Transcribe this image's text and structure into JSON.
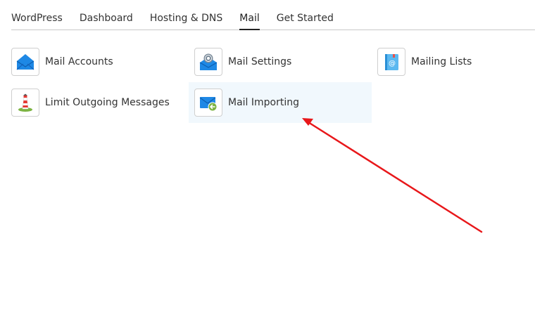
{
  "tabs": [
    {
      "label": "WordPress",
      "active": false
    },
    {
      "label": "Dashboard",
      "active": false
    },
    {
      "label": "Hosting & DNS",
      "active": false
    },
    {
      "label": "Mail",
      "active": true
    },
    {
      "label": "Get Started",
      "active": false
    }
  ],
  "tools": {
    "mail_accounts": {
      "label": "Mail Accounts",
      "icon": "mail-envelope-icon"
    },
    "mail_settings": {
      "label": "Mail Settings",
      "icon": "mail-settings-gear-icon"
    },
    "mailing_lists": {
      "label": "Mailing Lists",
      "icon": "address-book-at-icon"
    },
    "limit_outgoing": {
      "label": "Limit Outgoing Messages",
      "icon": "lighthouse-icon"
    },
    "mail_importing": {
      "label": "Mail Importing",
      "icon": "mail-import-arrow-icon",
      "highlighted": true
    }
  },
  "colors": {
    "accent_blue": "#2a9df4",
    "annotation_arrow": "#e8171a",
    "highlight_bg": "#f1f8fd"
  }
}
